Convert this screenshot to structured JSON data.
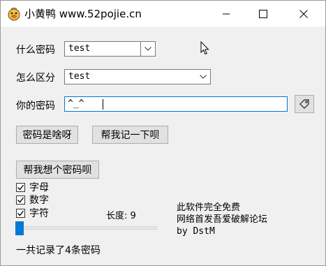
{
  "window": {
    "title": "小黄鸭 www.52pojie.cn",
    "icon": "duck-icon"
  },
  "form": {
    "what_password_label": "什么密码",
    "what_password_value": "test",
    "distinguish_label": "怎么区分",
    "distinguish_value": "test",
    "your_password_label": "你的密码",
    "your_password_value": "^_^"
  },
  "buttons": {
    "what_is_password": "密码是啥呀",
    "remember": "帮我记一下呗",
    "generate": "帮我想个密码呗",
    "copy_icon": "tag-icon"
  },
  "options": {
    "letters": "字母",
    "letters_checked": true,
    "digits": "数字",
    "digits_checked": true,
    "symbols": "字符",
    "symbols_checked": true,
    "length_label": "长度: 9",
    "length_value": 9
  },
  "info": {
    "line1": "此软件完全免费",
    "line2": "网络首发吾爱破解论坛",
    "line3": "by DstM"
  },
  "status": {
    "records": "一共记录了4条密码"
  },
  "colors": {
    "accent": "#0078d7",
    "window_bg": "#f0f0f0",
    "button_bg": "#e1e1e1"
  }
}
